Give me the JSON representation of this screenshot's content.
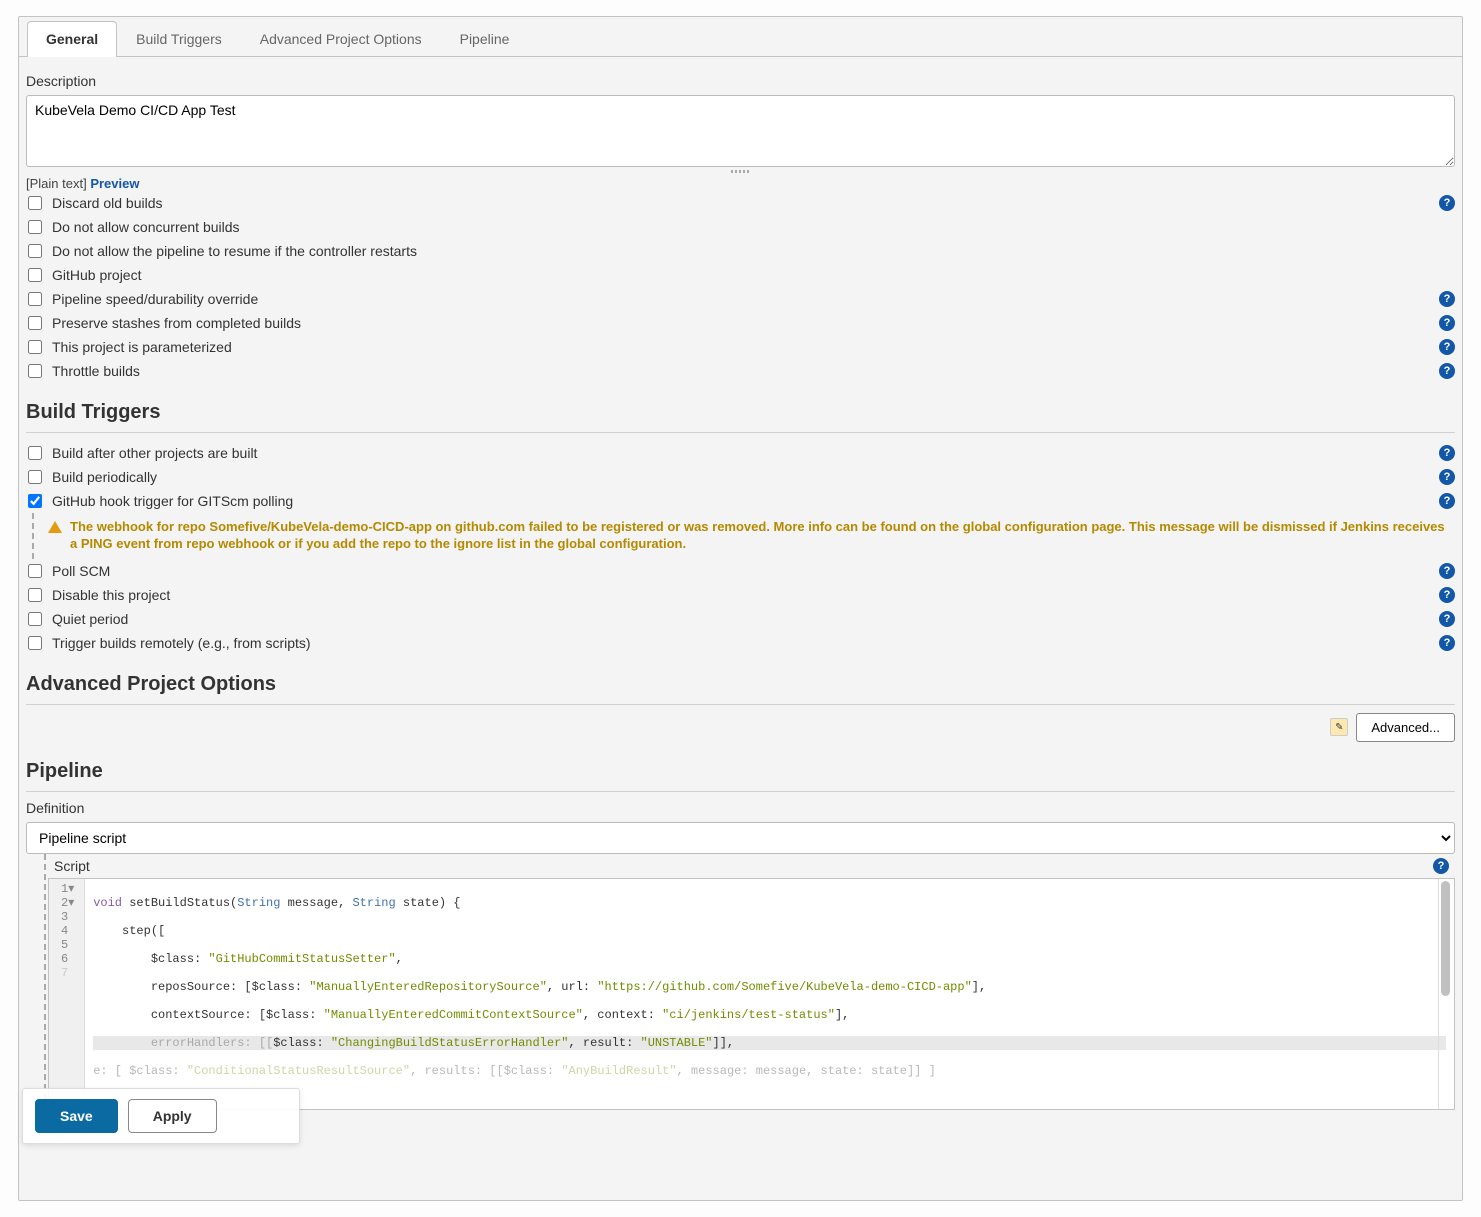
{
  "tabs": {
    "general": "General",
    "build_triggers": "Build Triggers",
    "advanced": "Advanced Project Options",
    "pipeline": "Pipeline"
  },
  "general": {
    "description_label": "Description",
    "description_value": "KubeVela Demo CI/CD App Test",
    "plain_text": "[Plain text]",
    "preview": "Preview",
    "opts": {
      "discard": "Discard old builds",
      "no_concurrent": "Do not allow concurrent builds",
      "no_resume": "Do not allow the pipeline to resume if the controller restarts",
      "github_project": "GitHub project",
      "speed": "Pipeline speed/durability override",
      "preserve": "Preserve stashes from completed builds",
      "parameterized": "This project is parameterized",
      "throttle": "Throttle builds"
    }
  },
  "triggers": {
    "title": "Build Triggers",
    "build_after": "Build after other projects are built",
    "periodic": "Build periodically",
    "github_hook": "GitHub hook trigger for GITScm polling",
    "warning": "The webhook for repo Somefive/KubeVela-demo-CICD-app on github.com failed to be registered or was removed. More info can be found on the global configuration page. This message will be dismissed if Jenkins receives a PING event from repo webhook or if you add the repo to the ignore list in the global configuration.",
    "poll_scm": "Poll SCM",
    "disable": "Disable this project",
    "quiet": "Quiet period",
    "remote": "Trigger builds remotely (e.g., from scripts)"
  },
  "advanced": {
    "title": "Advanced Project Options",
    "button": "Advanced..."
  },
  "pipeline": {
    "title": "Pipeline",
    "definition_label": "Definition",
    "definition_value": "Pipeline script",
    "script_label": "Script",
    "code": {
      "l1_kw": "void",
      "l1_fn": " setBuildStatus(",
      "l1_t1": "String",
      "l1_m": " message, ",
      "l1_t2": "String",
      "l1_end": " state) {",
      "l2": "    step([",
      "l3a": "        $class: ",
      "l3b": "\"GitHubCommitStatusSetter\"",
      "l3c": ",",
      "l4a": "        reposSource: [$class: ",
      "l4b": "\"ManuallyEnteredRepositorySource\"",
      "l4c": ", url: ",
      "l4d": "\"https://github.com/Somefive/KubeVela-demo-CICD-app\"",
      "l4e": "],",
      "l5a": "        contextSource: [$class: ",
      "l5b": "\"ManuallyEnteredCommitContextSource\"",
      "l5c": ", context: ",
      "l5d": "\"ci/jenkins/test-status\"",
      "l5e": "],",
      "l6a": "        errorHandlers: [[",
      "l6b": "$class: ",
      "l6c": "\"ChangingBuildStatusErrorHandler\"",
      "l6d": ", result: ",
      "l6e": "\"UNSTABLE\"",
      "l6f": "]],",
      "l7a": "e: [ $class: ",
      "l7b": "\"ConditionalStatusResultSource\"",
      "l7c": ", results: [[$class: ",
      "l7d": "\"AnyBuildResult\"",
      "l7e": ", message: message, state: state]] ]"
    }
  },
  "footer": {
    "save": "Save",
    "apply": "Apply"
  }
}
